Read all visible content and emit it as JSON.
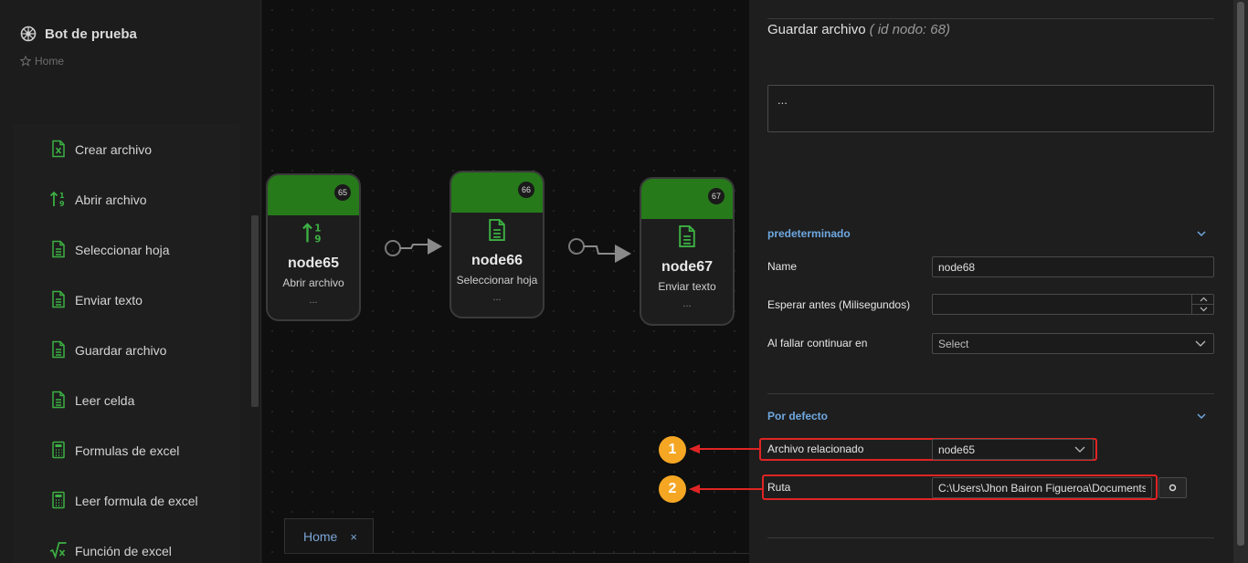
{
  "app": {
    "title": "Bot de prueba",
    "breadcrumb": "Home"
  },
  "sidebar": {
    "items": [
      {
        "label": "Crear archivo",
        "icon": "excel-file-icon"
      },
      {
        "label": "Abrir archivo",
        "icon": "sort-numeric-icon"
      },
      {
        "label": "Seleccionar hoja",
        "icon": "document-icon"
      },
      {
        "label": "Enviar texto",
        "icon": "document-icon"
      },
      {
        "label": "Guardar archivo",
        "icon": "document-icon"
      },
      {
        "label": "Leer celda",
        "icon": "document-icon"
      },
      {
        "label": "Formulas de excel",
        "icon": "calculator-icon"
      },
      {
        "label": "Leer formula de excel",
        "icon": "calculator-icon"
      },
      {
        "label": "Función de excel",
        "icon": "square-root-icon"
      }
    ]
  },
  "canvas": {
    "nodes": [
      {
        "id": "65",
        "name": "node65",
        "subtitle": "Abrir archivo",
        "dots": "..."
      },
      {
        "id": "66",
        "name": "node66",
        "subtitle": "Seleccionar hoja",
        "dots": "..."
      },
      {
        "id": "67",
        "name": "node67",
        "subtitle": "Enviar texto",
        "dots": "..."
      }
    ],
    "tab": {
      "label": "Home",
      "close": "×"
    }
  },
  "panel": {
    "title": "Guardar archivo",
    "node_id_text": "( id nodo: 68)",
    "description": "...",
    "section1": {
      "title": "predeterminado",
      "fields": {
        "name_label": "Name",
        "name_value": "node68",
        "wait_label": "Esperar antes (Milisegundos)",
        "wait_value": "",
        "fail_label": "Al fallar continuar en",
        "fail_value": "Select"
      }
    },
    "section2": {
      "title": "Por defecto",
      "fields": {
        "file_label": "Archivo relacionado",
        "file_value": "node65",
        "path_label": "Ruta",
        "path_value": "C:\\Users\\Jhon Bairon Figueroa\\Documents\\w"
      }
    }
  },
  "annotations": {
    "one": "1",
    "two": "2"
  },
  "colors": {
    "accent": "#6ea8e0",
    "node_header": "#267a1a",
    "highlight": "#e02424",
    "badge": "#f5a623",
    "icon_green": "#3cb043"
  }
}
